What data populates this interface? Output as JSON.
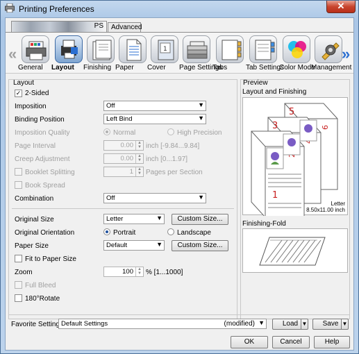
{
  "window": {
    "title": "Printing Preferences",
    "close": "✕"
  },
  "tabs": {
    "blurred_label": "PS",
    "advanced": "Advanced"
  },
  "toolbar": {
    "items": [
      {
        "label": "General",
        "icon": "printer-icon"
      },
      {
        "label": "Layout",
        "icon": "layout-icon",
        "active": true
      },
      {
        "label": "Finishing",
        "icon": "finishing-icon"
      },
      {
        "label": "Paper",
        "icon": "paper-icon"
      },
      {
        "label": "Cover",
        "icon": "cover-icon"
      },
      {
        "label": "Page Settings",
        "icon": "page-settings-icon"
      },
      {
        "label": "Tabs",
        "icon": "tabs-icon"
      },
      {
        "label": "Tab Settings",
        "icon": "tab-settings-icon"
      },
      {
        "label": "Color Mode",
        "icon": "color-mode-icon"
      },
      {
        "label": "Management",
        "icon": "management-icon"
      }
    ]
  },
  "layout": {
    "title": "Layout",
    "two_sided": "2-Sided",
    "imposition": {
      "label": "Imposition",
      "value": "Off"
    },
    "binding": {
      "label": "Binding Position",
      "value": "Left Bind"
    },
    "quality": {
      "label": "Imposition Quality",
      "normal": "Normal",
      "high": "High Precision"
    },
    "page_interval": {
      "label": "Page Interval",
      "value": "0.00",
      "range": "inch [-9.84...9.84]"
    },
    "creep": {
      "label": "Creep Adjustment",
      "value": "0.00",
      "range": "inch [0...1.97]"
    },
    "booklet": {
      "label": "Booklet Splitting",
      "value": "1",
      "unit": "Pages per Section"
    },
    "book_spread": "Book Spread",
    "combination": {
      "label": "Combination",
      "value": "Off"
    },
    "original_size": {
      "label": "Original Size",
      "value": "Letter",
      "button": "Custom Size..."
    },
    "orientation": {
      "label": "Original Orientation",
      "portrait": "Portrait",
      "landscape": "Landscape"
    },
    "paper_size": {
      "label": "Paper Size",
      "value": "Default",
      "button": "Custom Size..."
    },
    "fit_paper": "Fit to Paper Size",
    "zoom": {
      "label": "Zoom",
      "value": "100",
      "range": "% [1...1000]"
    },
    "full_bleed": "Full Bleed",
    "rotate": "180°Rotate"
  },
  "preview": {
    "title": "Preview",
    "layout_finishing": "Layout and Finishing",
    "page_numbers": [
      "1",
      "2",
      "3",
      "4",
      "5",
      "6"
    ],
    "paper_caption_1": "Letter",
    "paper_caption_2": "8.50x11.00 inch",
    "finishing_fold": "Finishing-Fold"
  },
  "favorite": {
    "label": "Favorite Setting",
    "value": "Default Settings",
    "modified": "(modified)",
    "load": "Load",
    "save": "Save"
  },
  "footer": {
    "ok": "OK",
    "cancel": "Cancel",
    "help": "Help"
  }
}
